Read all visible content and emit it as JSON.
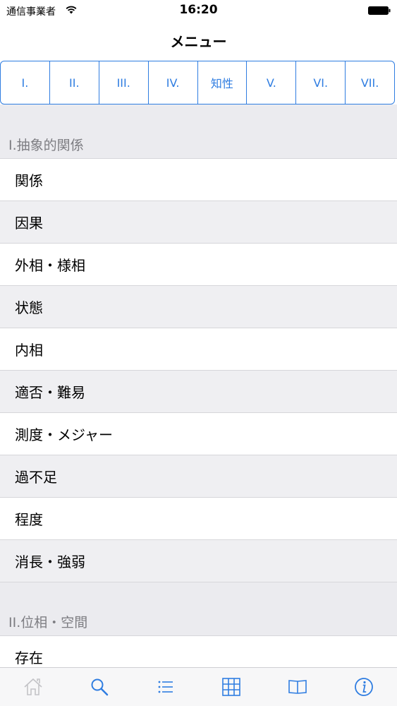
{
  "status_bar": {
    "carrier": "通信事業者",
    "time": "16:20"
  },
  "nav": {
    "title": "メニュー"
  },
  "segments": [
    "I.",
    "II.",
    "III.",
    "IV.",
    "知性",
    "V.",
    "VI.",
    "VII."
  ],
  "sections": [
    {
      "header": "I.抽象的関係",
      "rows": [
        "関係",
        "因果",
        "外相・様相",
        "状態",
        "内相",
        "適否・難易",
        "測度・メジャー",
        "過不足",
        "程度",
        "消長・強弱"
      ]
    },
    {
      "header": "II.位相・空間",
      "rows": [
        "存在"
      ]
    }
  ],
  "tab_bar": {
    "icons": [
      "home-icon",
      "search-icon",
      "list-icon",
      "grid-icon",
      "book-icon",
      "info-icon"
    ],
    "active_index": 3
  },
  "colors": {
    "accent": "#2f7de1",
    "section_bg": "#ebebef",
    "header_text": "#7d7d82"
  }
}
